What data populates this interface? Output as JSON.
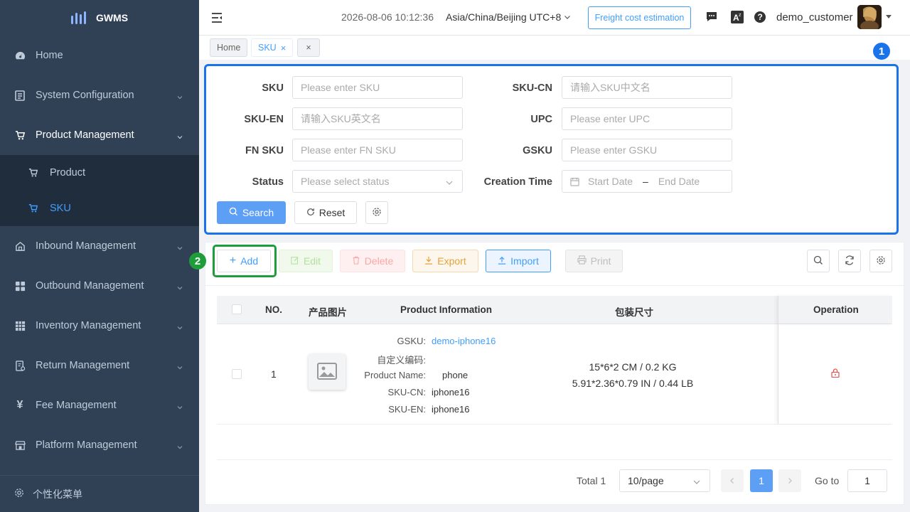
{
  "sidebar": {
    "brand": "GWMS",
    "items": [
      {
        "label": "Home"
      },
      {
        "label": "System Configuration"
      },
      {
        "label": "Product Management"
      },
      {
        "label": "Inbound Management"
      },
      {
        "label": "Outbound Management"
      },
      {
        "label": "Inventory Management"
      },
      {
        "label": "Return Management"
      },
      {
        "label": "Fee Management"
      },
      {
        "label": "Platform Management"
      }
    ],
    "sub_items": [
      {
        "label": "Product"
      },
      {
        "label": "SKU",
        "active": true
      }
    ],
    "footer_label": "个性化菜单"
  },
  "header": {
    "datetime": "2026-08-06 10:12:36",
    "timezone": "Asia/China/Beijing UTC+8",
    "freight_button": "Freight cost estimation",
    "username": "demo_customer"
  },
  "tags": {
    "home": "Home",
    "sku": "SKU",
    "sku_close": "×",
    "close_all": "×"
  },
  "badges": {
    "one": "1",
    "two": "2"
  },
  "search": {
    "sku_label": "SKU",
    "sku_placeholder": "Please enter SKU",
    "sku_cn_label": "SKU-CN",
    "sku_cn_placeholder": "请输入SKU中文名",
    "sku_en_label": "SKU-EN",
    "sku_en_placeholder": "请输入SKU英文名",
    "upc_label": "UPC",
    "upc_placeholder": "Please enter UPC",
    "fnsku_label": "FN SKU",
    "fnsku_placeholder": "Please enter FN SKU",
    "gsku_label": "GSKU",
    "gsku_placeholder": "Please enter GSKU",
    "status_label": "Status",
    "status_placeholder": "Please select status",
    "creation_label": "Creation Time",
    "start_date": "Start Date",
    "date_sep": "–",
    "end_date": "End Date",
    "search_button": "Search",
    "reset_button": "Reset"
  },
  "toolbar": {
    "add": "Add",
    "edit": "Edit",
    "delete": "Delete",
    "export": "Export",
    "import": "Import",
    "print": "Print"
  },
  "table": {
    "columns": [
      "NO.",
      "产品图片",
      "Product Information",
      "包装尺寸",
      "Operation"
    ],
    "rows": [
      {
        "no": "1",
        "gsku_key": "GSKU:",
        "gsku": "demo-iphone16",
        "custom_key": "自定义编码:",
        "custom": "",
        "name_key": "Product Name:",
        "name": "phone",
        "sku_cn_key": "SKU-CN:",
        "sku_cn": "iphone16",
        "sku_en_key": "SKU-EN:",
        "sku_en": "iphone16",
        "size_metric": "15*6*2 CM / 0.2 KG",
        "size_imperial": "5.91*2.36*0.79 IN / 0.44 LB"
      }
    ]
  },
  "pagination": {
    "total": "Total 1",
    "page_size": "10/page",
    "current_page": "1",
    "goto_label": "Go to",
    "goto_value": "1"
  },
  "colors": {
    "sidebar_bg": "#304156",
    "primary": "#409eff",
    "highlight_blue": "#1a73e8",
    "highlight_green": "#1e9e3a"
  }
}
